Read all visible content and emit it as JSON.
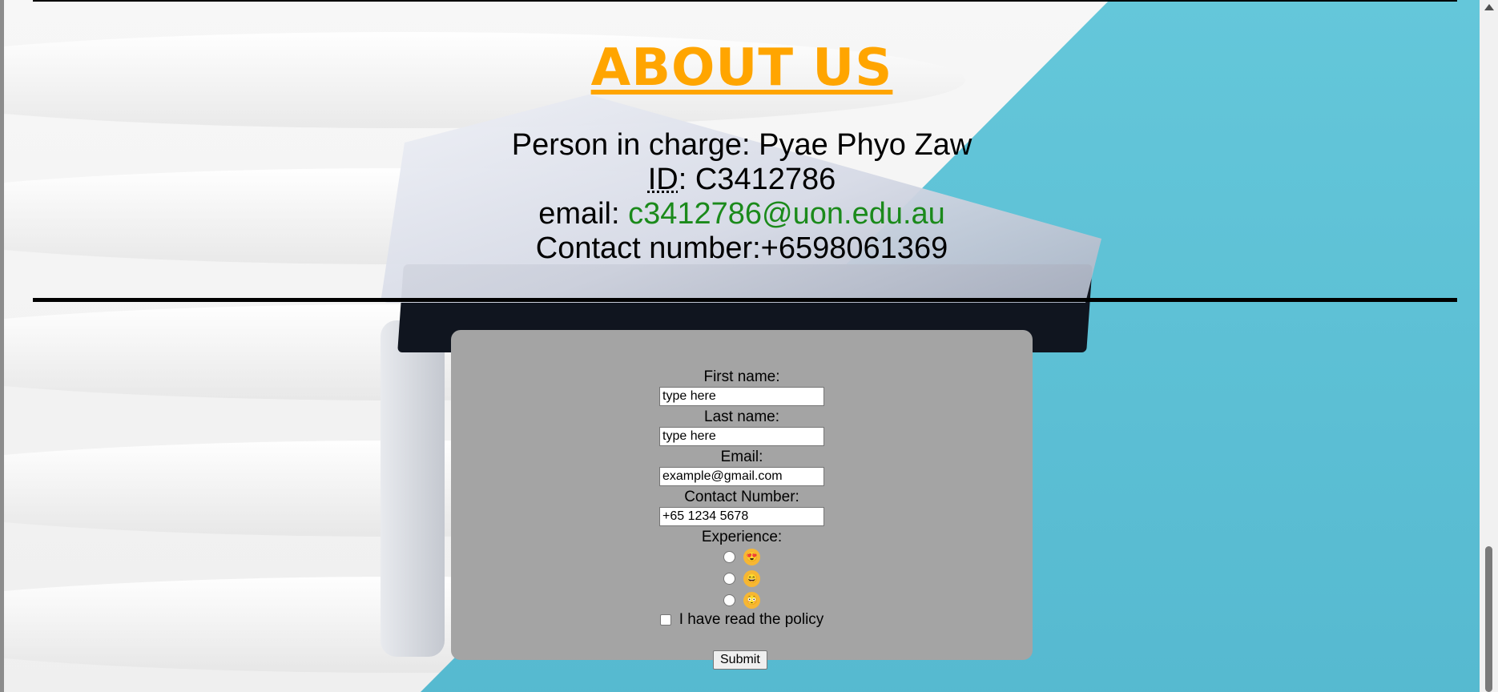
{
  "about": {
    "title": "ABOUT US",
    "person_label": "Person in charge: Pyae Phyo Zaw",
    "id_abbr": "ID",
    "id_value": ": C3412786",
    "email_label": "email: ",
    "email_link": "c3412786@uon.edu.au",
    "contact": "Contact number:+6598061369"
  },
  "form": {
    "first_name_label": "First name:",
    "first_name_placeholder": "type here",
    "last_name_label": "Last name:",
    "last_name_placeholder": "type here",
    "email_label": "Email:",
    "email_placeholder": "example@gmail.com",
    "contact_label": "Contact Number:",
    "contact_placeholder": "+65 1234 5678",
    "experience_label": "Experience:",
    "experience_options": [
      {
        "emoji": "😍",
        "icon": "heart-eyes-emoji-icon"
      },
      {
        "emoji": "😄",
        "icon": "grinning-emoji-icon"
      },
      {
        "emoji": "😳",
        "icon": "flushed-emoji-icon"
      }
    ],
    "policy_label": "I have read the policy",
    "submit_label": "Submit"
  },
  "colors": {
    "heading": "#ffa500",
    "link": "#1b8a1b",
    "form_bg": "#a4a4a4",
    "accent_teal": "#64c7da"
  }
}
